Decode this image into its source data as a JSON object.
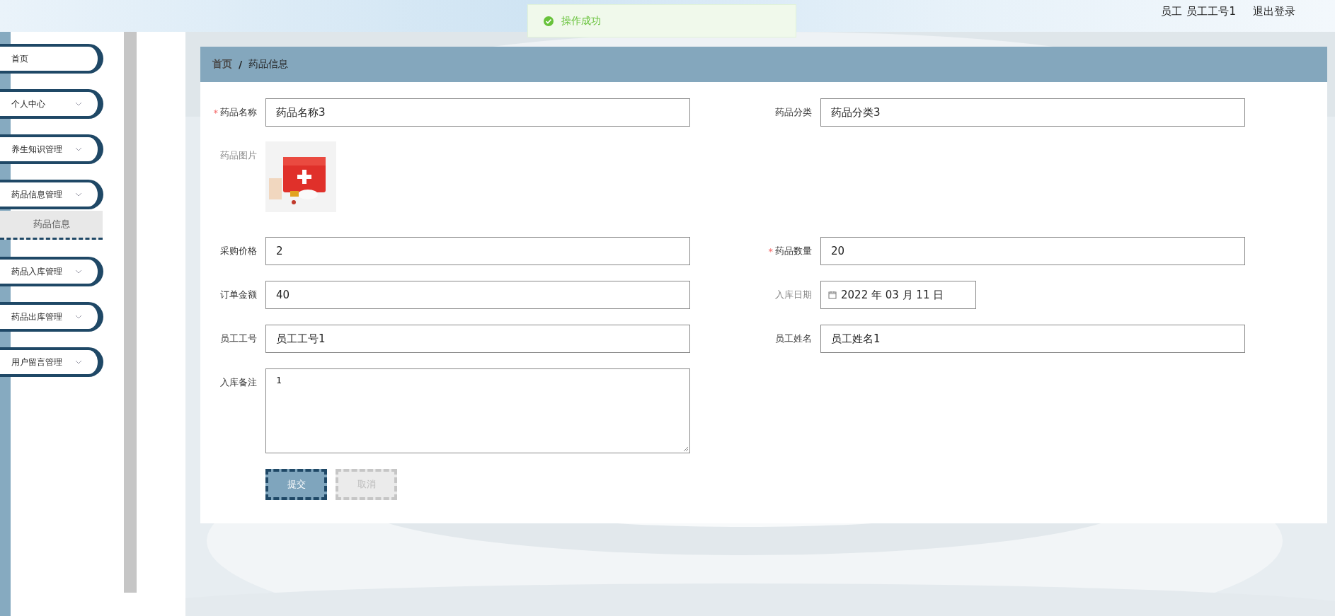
{
  "header": {
    "user_role": "员工",
    "user_name": "员工工号1",
    "logout": "退出登录"
  },
  "toast": {
    "kind": "success",
    "text": "操作成功"
  },
  "sidebar": {
    "items": [
      {
        "label": "首页",
        "kind": "link"
      },
      {
        "label": "个人中心",
        "kind": "menu"
      },
      {
        "label": "养生知识管理",
        "kind": "menu"
      },
      {
        "label": "药品信息管理",
        "kind": "menu",
        "children": [
          {
            "label": "药品信息"
          }
        ]
      },
      {
        "label": "药品入库管理",
        "kind": "menu"
      },
      {
        "label": "药品出库管理",
        "kind": "menu"
      },
      {
        "label": "用户留言管理",
        "kind": "menu"
      }
    ]
  },
  "breadcrumb": {
    "items": [
      "首页",
      "药品信息"
    ],
    "separator": "/"
  },
  "form": {
    "rows": [
      [
        {
          "label": "药品名称",
          "kind": "text",
          "required_mark": "*",
          "readonly": false,
          "value": "药品名称3"
        },
        {
          "label": "药品分类",
          "kind": "text",
          "readonly": false,
          "value": "药品分类3"
        }
      ],
      [
        {
          "label": "药品图片",
          "readonly": true
        }
      ],
      [
        {
          "label": "采购价格",
          "kind": "text",
          "readonly": false,
          "value": "2"
        },
        {
          "label": "药品数量",
          "kind": "text",
          "required_mark": "*",
          "readonly": false,
          "value": "20"
        }
      ],
      [
        {
          "label": "订单金额",
          "kind": "text",
          "readonly": false,
          "value": "40"
        },
        {
          "label": "入库日期",
          "kind": "date",
          "readonly": true,
          "value": "2022 年 03 月 11 日"
        }
      ],
      [
        {
          "label": "员工工号",
          "kind": "text",
          "readonly": false,
          "value": "员工工号1"
        },
        {
          "label": "员工姓名",
          "kind": "text",
          "readonly": false,
          "value": "员工姓名1"
        }
      ],
      [
        {
          "label": "入库备注",
          "kind": "textarea",
          "readonly": false,
          "value": "1"
        }
      ]
    ],
    "buttons": [
      {
        "label": "提交",
        "kind": "primary"
      },
      {
        "label": "取消",
        "kind": "cancel"
      }
    ]
  }
}
